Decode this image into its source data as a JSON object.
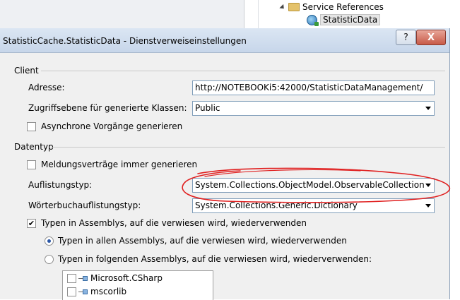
{
  "solution_explorer": {
    "service_references_label": "Service References",
    "statistic_data_label": "StatisticData"
  },
  "dialog": {
    "title": "StatisticCache.StatisticData - Dienstverweiseinstellungen",
    "help_button": "?",
    "close_button": "X"
  },
  "client": {
    "group_label": "Client",
    "address_label": "Adresse:",
    "address_value": "http://NOTEBOOKi5:42000/StatisticDataManagement/",
    "access_level_label": "Zugriffsebene für generierte Klassen:",
    "access_level_value": "Public",
    "async_label": "Asynchrone Vorgänge generieren",
    "async_checked": false
  },
  "datatype": {
    "group_label": "Datentyp",
    "always_generate_label": "Meldungsverträge immer generieren",
    "always_generate_checked": false,
    "collection_type_label": "Auflistungstyp:",
    "collection_type_value": "System.Collections.ObjectModel.ObservableCollection",
    "dictionary_type_label": "Wörterbuchauflistungstyp:",
    "dictionary_type_value": "System.Collections.Generic.Dictionary",
    "reuse_types_label": "Typen in Assemblys, auf die verwiesen wird, wiederverwenden",
    "reuse_types_checked": true,
    "reuse_all_label": "Typen in allen Assemblys, auf die verwiesen wird, wiederverwenden",
    "reuse_specified_label": "Typen in folgenden Assemblys, auf die verwiesen wird, wiederverwenden:",
    "assemblies": [
      {
        "name": "Microsoft.CSharp"
      },
      {
        "name": "mscorlib"
      }
    ]
  },
  "colors": {
    "annotation": "#e02020",
    "titlebar": "#c7d6ea",
    "radio_dot": "#2a56a6"
  }
}
